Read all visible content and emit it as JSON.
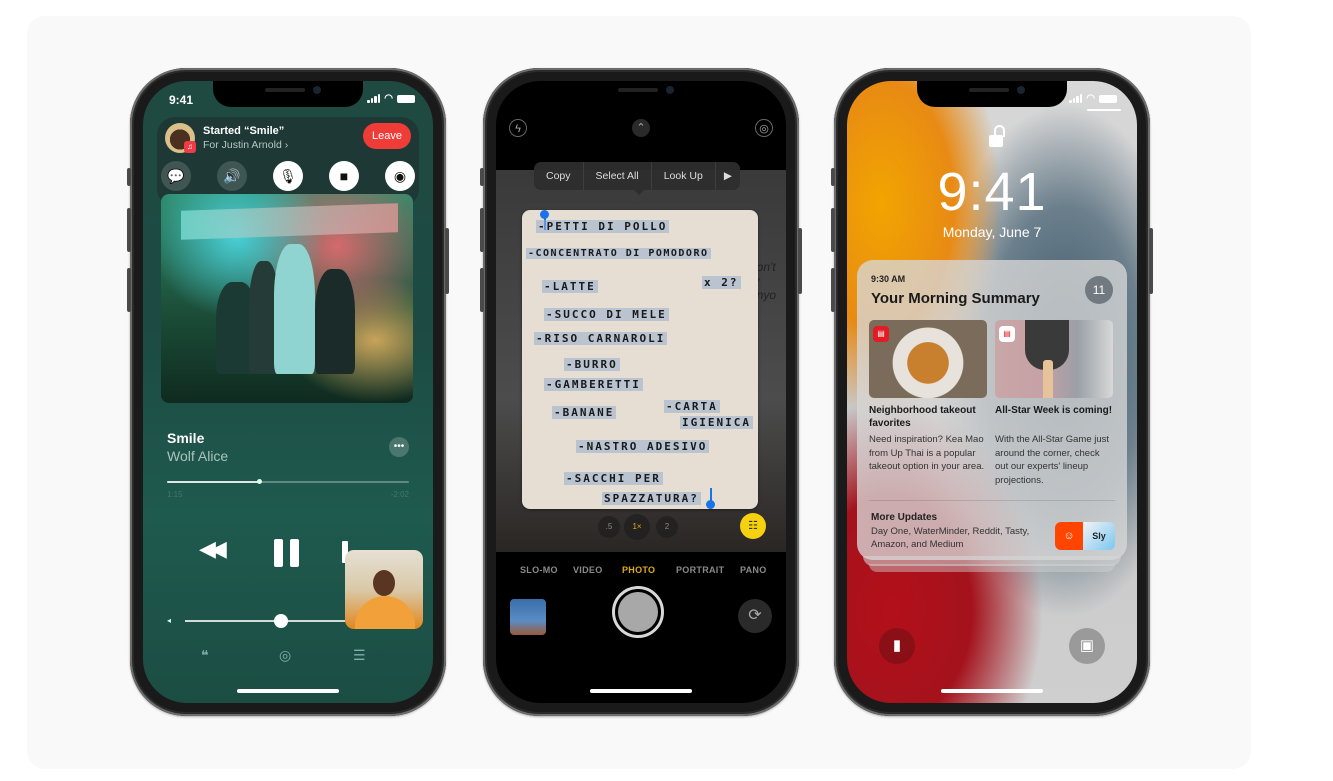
{
  "phones": {
    "shareplay": {
      "status_time": "9:41",
      "banner": {
        "title": "Started “Smile”",
        "subtitle": "For Justin Arnold ›",
        "leave_label": "Leave",
        "app_badge": "♫",
        "controls": [
          {
            "name": "messages",
            "glyph": "💬"
          },
          {
            "name": "speaker",
            "glyph": "🔊"
          },
          {
            "name": "microphone",
            "glyph": "🎙"
          },
          {
            "name": "camera",
            "glyph": "■"
          },
          {
            "name": "shareplay",
            "glyph": "◉"
          }
        ]
      },
      "now_playing": {
        "title": "Smile",
        "artist": "Wolf Alice",
        "more_glyph": "•••",
        "elapsed": "1:15",
        "remaining": "-2:02",
        "progress": 0.38,
        "volume": 0.6,
        "rewind_glyph": "◀◀",
        "volume_low_glyph": "◂",
        "bottom_icons": {
          "lyrics": "❝",
          "airplay": "◎",
          "queue": "☰"
        }
      }
    },
    "camera": {
      "icons": {
        "flash": "ϟ",
        "chevron": "⌃",
        "live": "◎",
        "livetext": "☷",
        "flip": "⟳"
      },
      "context_menu": [
        "Copy",
        "Select All",
        "Look Up",
        "▶"
      ],
      "note_lines": [
        "-PETTI DI POLLO",
        "-CONCENTRATO DI POMODORO",
        "-LATTE",
        "x 2?",
        "-SUCCO DI MELE",
        "-RISO CARNAROLI",
        "-BURRO",
        "-GAMBERETTI",
        "-BANANE",
        "-CARTA",
        "IGIENICA",
        "-NASTRO ADESIVO",
        "-SACCHI PER",
        "SPAZZATURA?"
      ],
      "background_scribble": "don't\nfy\nanyo",
      "zoom_levels": [
        ".5",
        "1×",
        "2"
      ],
      "active_zoom": "1×",
      "modes": [
        "SLO-MO",
        "VIDEO",
        "PHOTO",
        "PORTRAIT",
        "PANO"
      ],
      "active_mode": "PHOTO"
    },
    "lockscreen": {
      "time": "9:41",
      "date": "Monday, June 7",
      "summary": {
        "time": "9:30 AM",
        "title": "Your Morning Summary",
        "count": "11",
        "stories": [
          {
            "headline": "Neighborhood takeout favorites",
            "body": "Need inspiration? Kea Mao from Up Thai is a popular takeout option in your area.",
            "badge": "▤"
          },
          {
            "headline": "All-Star Week is coming!",
            "body": "With the All-Star Game just around the corner, check out our experts' lineup projections.",
            "badge": "▤"
          }
        ],
        "more_title": "More Updates",
        "more_body": "Day One, WaterMinder, Reddit, Tasty, Amazon, and Medium",
        "more_icon_reddit": "☺",
        "more_icon_tasty": "Sly"
      },
      "flashlight_glyph": "▮",
      "camera_glyph": "▣"
    }
  },
  "colors": {
    "leave_red": "#f03c36",
    "shareplay_bg": "#1f4a42",
    "camera_active": "#e1a91a",
    "livetext_yellow": "#f5d10f",
    "selection_blue": "#1a73e8"
  }
}
